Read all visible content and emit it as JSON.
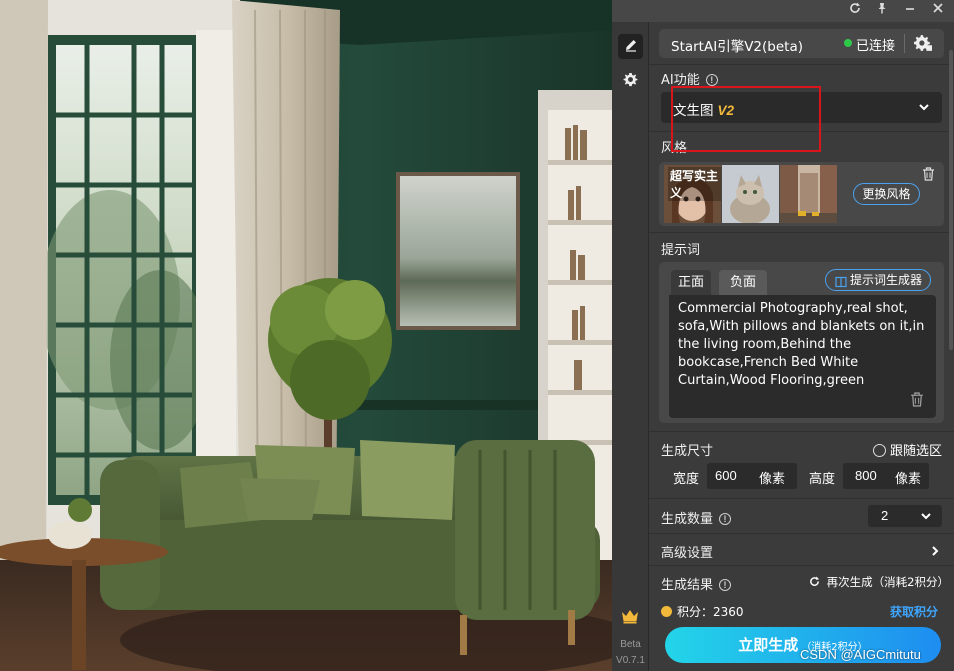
{
  "window": {
    "refresh_icon": "refresh-icon",
    "pin_icon": "pin-icon",
    "minimize_icon": "minimize-icon",
    "close_icon": "close-icon"
  },
  "rail": {
    "items": [
      {
        "name": "edit",
        "icon": "pencil-icon",
        "active": true
      },
      {
        "name": "settings",
        "icon": "gear-icon",
        "active": false
      }
    ],
    "vip_icon": "crown-icon",
    "beta_label": "Beta",
    "version": "V0.7.1"
  },
  "engine": {
    "name": "StartAI引擎V2(beta)",
    "status": "已连接",
    "status_color": "#2fc94a"
  },
  "ai_function": {
    "label": "AI功能",
    "selected": "文生图",
    "selected_badge": "V2"
  },
  "style": {
    "label": "风格",
    "thumb_title": "超写实主义",
    "change_button": "更换风格"
  },
  "prompt": {
    "label": "提示词",
    "tabs": [
      "正面",
      "负面"
    ],
    "active_tab": "正面",
    "generator_button": "提示词生成器",
    "text": "Commercial Photography,real shot, sofa,With pillows and blankets on it,in the living room,Behind the bookcase,French Bed White Curtain,Wood Flooring,green"
  },
  "size": {
    "label": "生成尺寸",
    "follow_selection": "跟随选区",
    "width_label": "宽度",
    "width_value": "600",
    "width_unit": "像素",
    "height_label": "高度",
    "height_value": "800",
    "height_unit": "像素"
  },
  "count": {
    "label": "生成数量",
    "value": "2"
  },
  "advanced": {
    "label": "高级设置"
  },
  "result": {
    "label": "生成结果",
    "regenerate": "再次生成（消耗2积分）"
  },
  "points": {
    "text": "积分：2360",
    "get_link": "获取积分"
  },
  "generate": {
    "label": "立即生成",
    "cost": "（消耗2积分）"
  },
  "watermark": "CSDN @AIGCmitutu",
  "colors": {
    "accent": "#1e8df0",
    "accent_light": "#23d5e8",
    "badge_gold": "#f2b93b",
    "highlight_red": "#d9141b"
  }
}
